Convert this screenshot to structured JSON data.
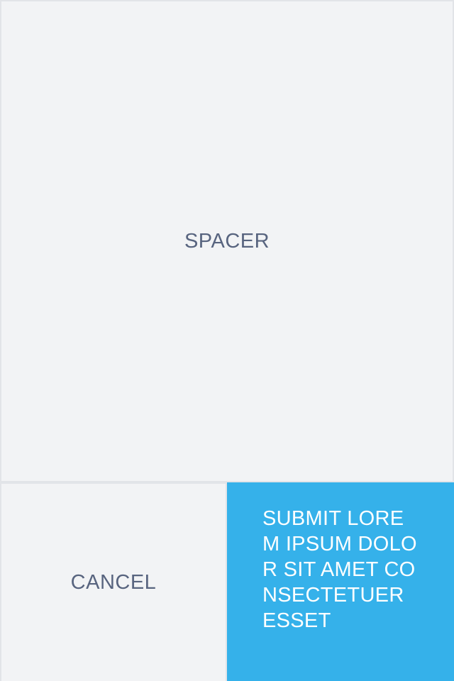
{
  "spacer": {
    "label": "SPACER"
  },
  "actions": {
    "cancel_label": "CANCEL",
    "submit_label": "SUBMIT LOREM IPSUM DOLOR SIT AMET CONSECTETUER ESSET"
  },
  "colors": {
    "background": "#e2e4e8",
    "panel": "#f2f3f5",
    "text": "#58647f",
    "accent": "#35b1ea",
    "accent_text": "#ffffff"
  }
}
